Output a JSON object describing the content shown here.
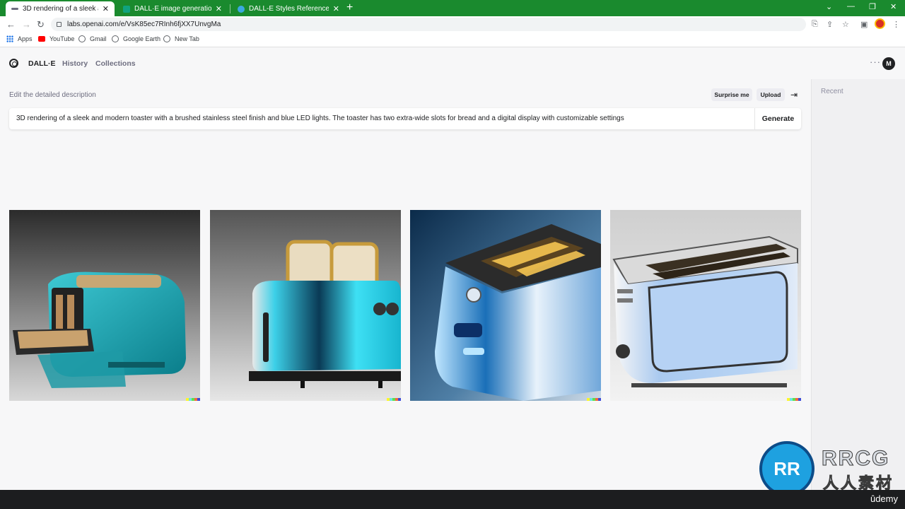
{
  "browser": {
    "tabs": [
      {
        "title": "3D rendering of a sleek and mod",
        "active": true
      },
      {
        "title": "DALL·E image generation.",
        "active": false
      },
      {
        "title": "DALL-E Styles Reference with Pro",
        "active": false
      }
    ],
    "url": "labs.openai.com/e/VsK85ec7RInh6fjXX7UnvgMa",
    "bookmarks": [
      "Apps",
      "YouTube",
      "Gmail",
      "Google Earth",
      "New Tab"
    ]
  },
  "app": {
    "brand": "DALL·E",
    "nav": [
      "History",
      "Collections"
    ],
    "more_icon": "···",
    "avatar_initial": "M"
  },
  "editor": {
    "label": "Edit the detailed description",
    "surprise_label": "Surprise me",
    "upload_label": "Upload",
    "prompt": "3D rendering of a sleek and modern toaster with a brushed stainless steel finish and blue LED lights. The toaster has two extra-wide slots for bread and a digital display with customizable settings",
    "generate_label": "Generate"
  },
  "sidebar": {
    "recent_label": "Recent"
  },
  "results": {
    "images": [
      {
        "subject": "teal toaster with open tray"
      },
      {
        "subject": "cyan toaster with two toast slices"
      },
      {
        "subject": "chrome and blue toaster with glowing slots"
      },
      {
        "subject": "light blue chrome two-slot toaster"
      }
    ]
  },
  "watermark": {
    "text": "RRCG",
    "cn": "人人素材",
    "badge": "RR"
  },
  "footer": {
    "brand": "ûdemy"
  }
}
